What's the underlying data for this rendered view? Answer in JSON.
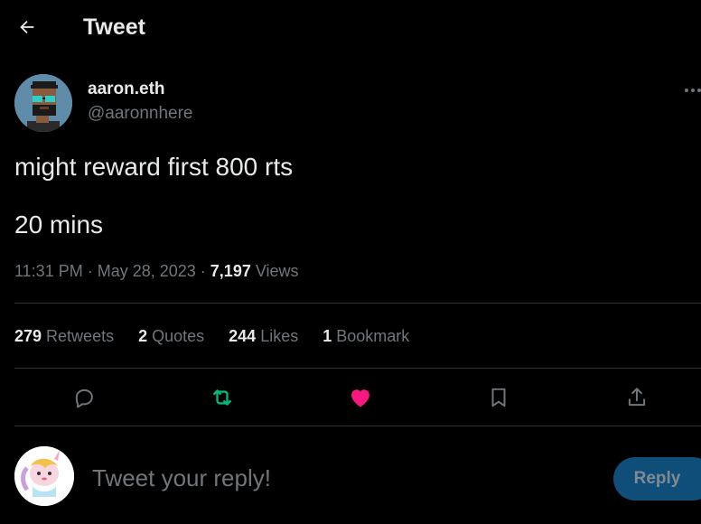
{
  "header": {
    "title": "Tweet",
    "back_icon": "arrow-left-icon"
  },
  "author": {
    "name": "aaron.eth",
    "handle": "@aaronnhere",
    "avatar_icon": "pixel-avatar"
  },
  "tweet": {
    "line1": "might reward first 800 rts",
    "line2": "20 mins",
    "time": "11:31 PM",
    "sep1": " · ",
    "date": "May 28, 2023",
    "sep2": " · ",
    "views_count": "7,197",
    "views_label": " Views"
  },
  "stats": [
    {
      "count": "279",
      "label": " Retweets"
    },
    {
      "count": "2",
      "label": " Quotes"
    },
    {
      "count": "244",
      "label": " Likes"
    },
    {
      "count": "1",
      "label": " Bookmark"
    }
  ],
  "actions": {
    "reply": "comment-icon",
    "retweet": "retweet-icon",
    "like": "heart-icon",
    "bookmark": "bookmark-icon",
    "share": "share-icon"
  },
  "reply": {
    "placeholder": "Tweet your reply!",
    "button": "Reply"
  },
  "colors": {
    "retweet": "#00ba7c",
    "like": "#f91880",
    "reply_button": "#0f4e78"
  }
}
